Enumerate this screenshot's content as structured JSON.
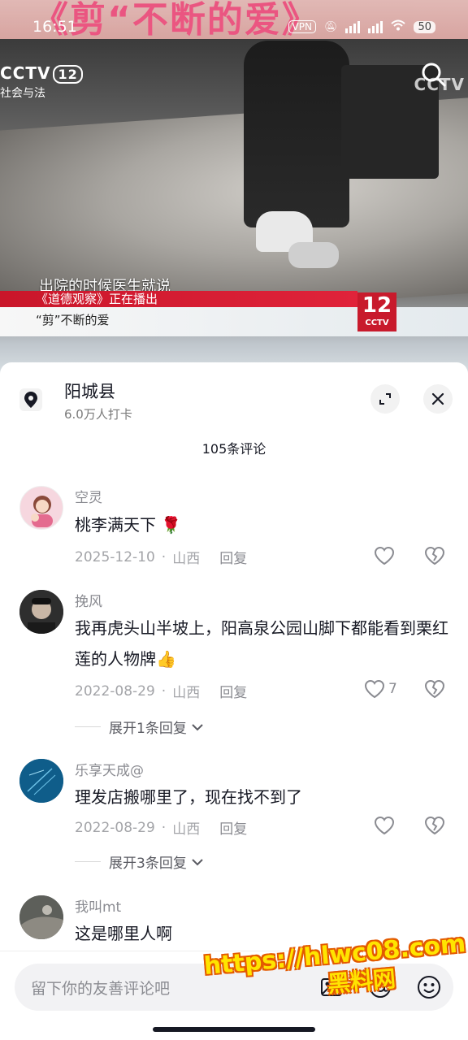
{
  "status_bar": {
    "time": "16:51",
    "vpn": "VPN",
    "battery": "50"
  },
  "video": {
    "banner_text": "《剪“不断的爱》",
    "channel_logo": "CCTV",
    "channel_number": "12",
    "channel_name": "社会与法",
    "watermark": "CCTV",
    "subtitle": "出院的时候医生就说",
    "now_playing": "《道德观察》正在播出",
    "program_title": "“剪”不断的爱",
    "badge_number": "12",
    "badge_brand": "CCTV"
  },
  "location": {
    "name": "阳城县",
    "checkins": "6.0万人打卡"
  },
  "comment_count": "105条评论",
  "comments": [
    {
      "user": "空灵",
      "text": "桃李满天下 🌹",
      "date": "2025-12-10",
      "region": "山西",
      "reply_label": "回复",
      "likes": "",
      "avatar_color": "#f6d7df"
    },
    {
      "user": "挽风",
      "text": "我再虎头山半坡上，阳高泉公园山脚下都能看到栗红莲的人物牌👍",
      "date": "2022-08-29",
      "region": "山西",
      "reply_label": "回复",
      "likes": "7",
      "expand": "展开1条回复",
      "avatar_color": "#3a3a3a"
    },
    {
      "user": "乐享天成@",
      "text": "理发店搬哪里了，现在找不到了",
      "date": "2022-08-29",
      "region": "山西",
      "reply_label": "回复",
      "likes": "",
      "expand": "展开3条回复",
      "avatar_color": "#0f5d8a"
    },
    {
      "user": "我叫mt",
      "text": "这是哪里人啊",
      "avatar_color": "#6b6b6b"
    }
  ],
  "input": {
    "placeholder": "留下你的友善评论吧"
  },
  "overlay_watermark": {
    "line1": "https://hlwc08.com",
    "line2": "黑料网"
  }
}
